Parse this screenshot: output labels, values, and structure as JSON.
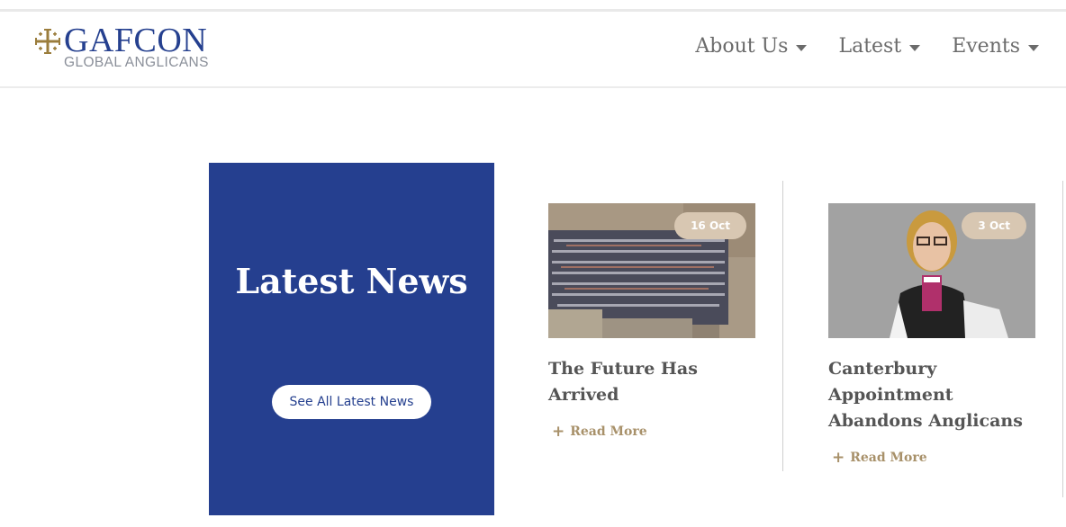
{
  "brand": {
    "name": "GAFCON",
    "tagline": "GLOBAL ANGLICANS"
  },
  "nav": {
    "items": [
      {
        "label": "About Us"
      },
      {
        "label": "Latest"
      },
      {
        "label": "Events"
      }
    ]
  },
  "hero": {
    "title": "Latest News",
    "button_label": "See All Latest News"
  },
  "posts": [
    {
      "date": "16 Oct",
      "title": "The Future Has Arrived",
      "read_more": "Read More"
    },
    {
      "date": "3 Oct",
      "title": "Canterbury Appointment Abandons Anglicans",
      "read_more": "Read More"
    }
  ],
  "colors": {
    "brand_blue": "#253f8f",
    "gold": "#a8916a",
    "badge": "#d8c7b2",
    "nav_text": "#6b6b6b"
  },
  "icons": {
    "logo": "jerusalem-cross-icon",
    "nav_caret": "caret-down-icon",
    "read_more": "plus-icon"
  }
}
